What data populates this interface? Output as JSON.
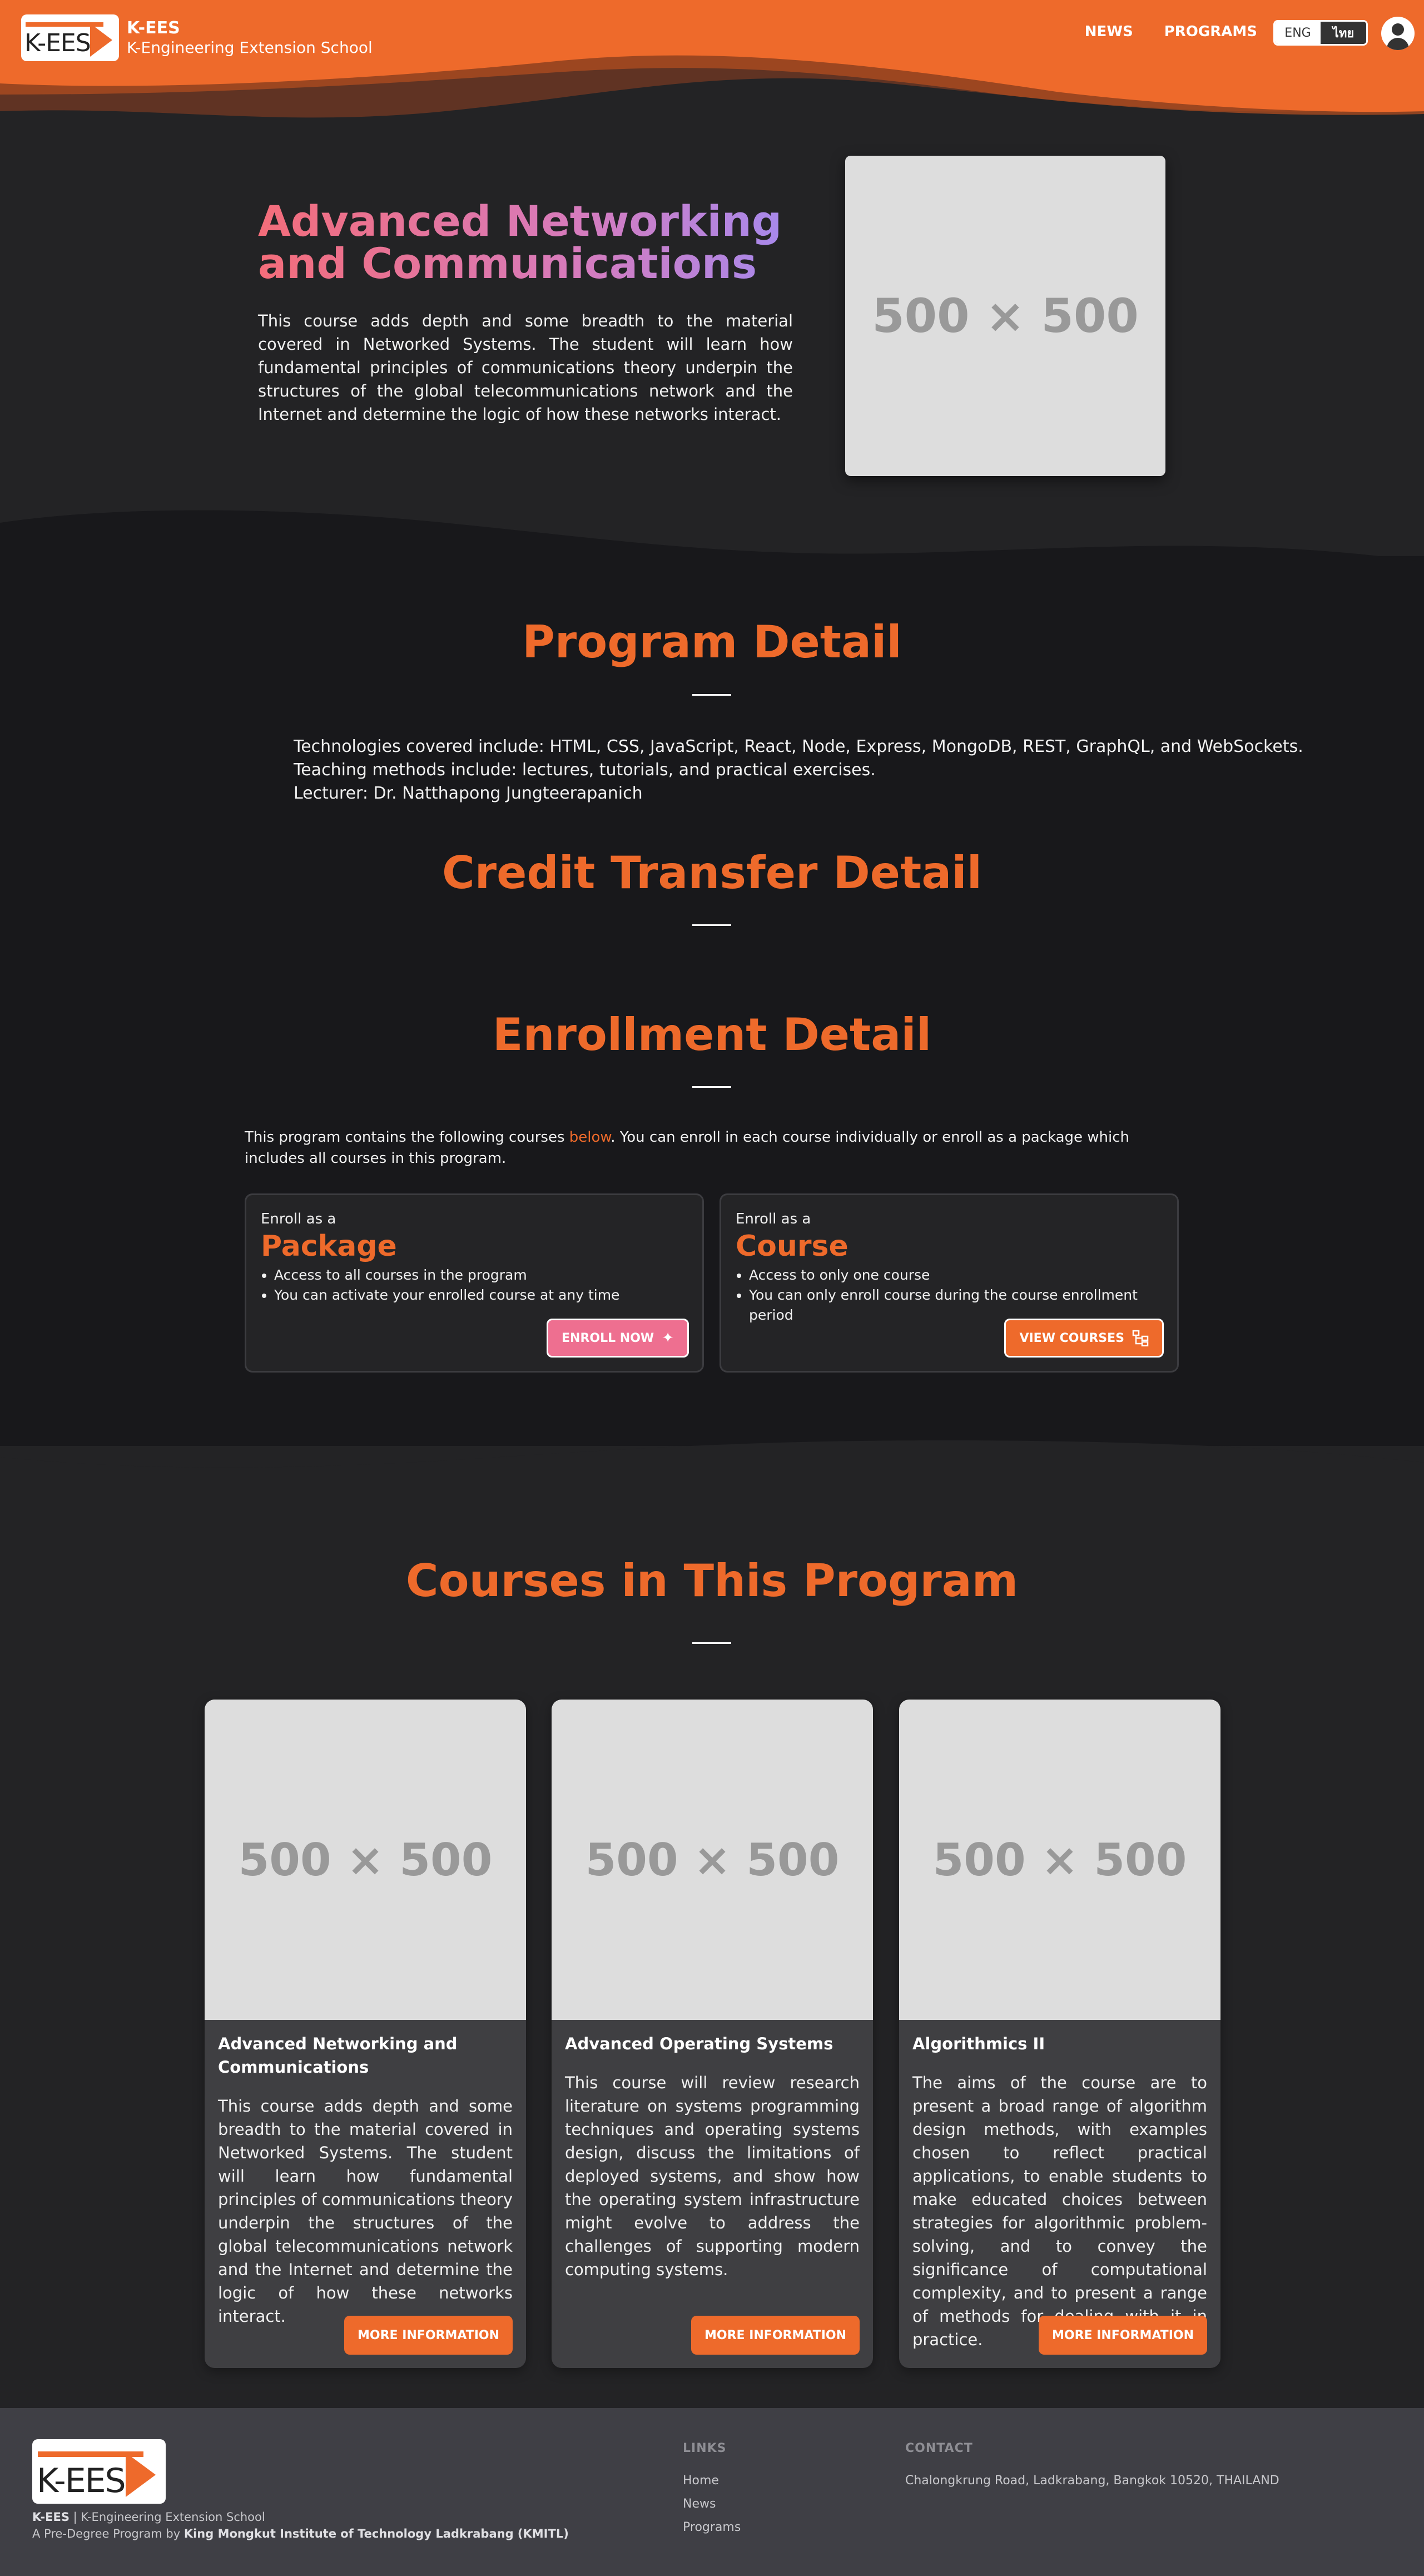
{
  "nav": {
    "logo_text": "K-EES",
    "brand_name": "K-EES",
    "brand_sub": "K-Engineering Extension School",
    "links": [
      "NEWS",
      "PROGRAMS"
    ],
    "lang": [
      "ENG",
      "ไทย"
    ],
    "accent_color": "#ee6a2b"
  },
  "hero": {
    "title": "Advanced Networking and Communications",
    "description": "This course adds depth and some breadth to the material covered in Networked Systems. The student will learn how fundamental principles of communications theory underpin the structures of the global telecommunications network and the Internet and determine the logic of how these networks interact.",
    "image_placeholder": "500 × 500"
  },
  "program_detail": {
    "title": "Program Detail",
    "lines": [
      "Technologies covered include: HTML, CSS, JavaScript, React, Node, Express, MongoDB, REST, GraphQL, and WebSockets.",
      "Teaching methods include: lectures, tutorials, and practical exercises.",
      "Lecturer: Dr. Natthapong Jungteerapanich"
    ]
  },
  "credit_transfer": {
    "title": "Credit Transfer Detail"
  },
  "enrollment": {
    "title": "Enrollment Detail",
    "intro_before": "This program contains the following courses ",
    "intro_link": "below",
    "intro_after": ". You can enroll in each course individually or enroll as a package which includes all courses in this program.",
    "package": {
      "kicker": "Enroll as a",
      "name": "Package",
      "bullets": [
        "Access to all courses in the program",
        "You can activate your enrolled course at any time"
      ],
      "button": "ENROLL NOW"
    },
    "course": {
      "kicker": "Enroll as a",
      "name": "Course",
      "bullets": [
        "Access to only one course",
        "You can only enroll course during the course enrollment period"
      ],
      "button": "VIEW COURSES"
    }
  },
  "courses": {
    "title": "Courses in This Program",
    "items": [
      {
        "image_placeholder": "500 × 500",
        "title": "Advanced Networking and Communications",
        "description": "This course adds depth and some breadth to the material covered in Networked Systems. The student will learn how fundamental principles of communications theory underpin the structures of the global telecommunications network and the Internet and determine the logic of how these networks interact.",
        "button": "MORE INFORMATION"
      },
      {
        "image_placeholder": "500 × 500",
        "title": "Advanced Operating Systems",
        "description": "This course will review research literature on systems programming techniques and operating systems design, discuss the limitations of deployed systems, and show how the operating system infrastructure might evolve to address the challenges of supporting modern computing systems.",
        "button": "MORE INFORMATION"
      },
      {
        "image_placeholder": "500 × 500",
        "title": "Algorithmics II",
        "description": "The aims of the course are to present a broad range of algorithm design methods, with examples chosen to reflect practical applications, to enable students to make educated choices between strategies for algorithmic problem-solving, and to convey the significance of computational complexity, and to present a range of methods for dealing with it in practice.",
        "button": "MORE INFORMATION"
      }
    ]
  },
  "footer": {
    "logo_text": "K-EES",
    "line1_bold": "K-EES",
    "line1_rest": " | K-Engineering Extension School",
    "line2_pre": "A Pre-Degree Program by ",
    "line2_bold": "King Mongkut Institute of Technology Ladkrabang (KMITL)",
    "links_heading": "LINKS",
    "links": [
      "Home",
      "News",
      "Programs"
    ],
    "contact_heading": "CONTACT",
    "address": "Chalongkrung Road, Ladkrabang, Bangkok 10520, THAILAND"
  }
}
